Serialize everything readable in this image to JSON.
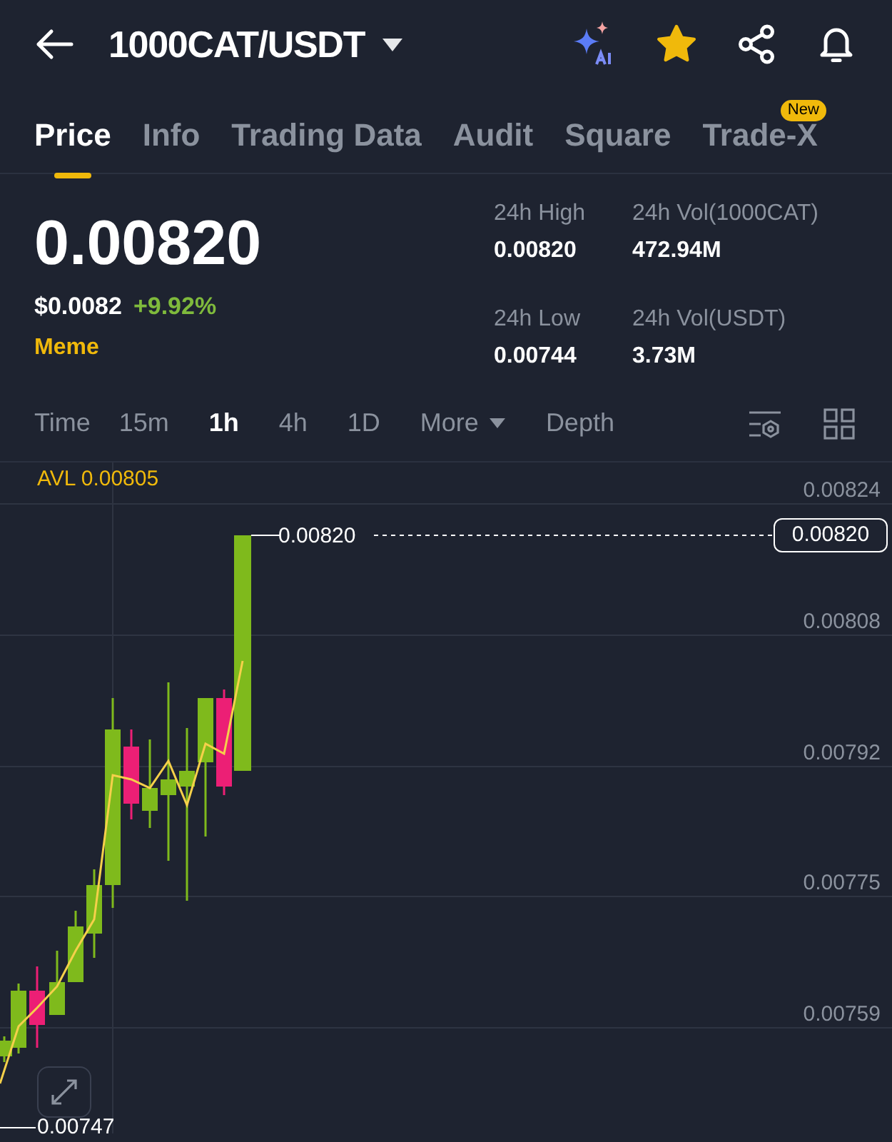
{
  "header": {
    "pair": "1000CAT/USDT",
    "favorite": true
  },
  "tabs": [
    {
      "label": "Price",
      "selected": true
    },
    {
      "label": "Info",
      "selected": false
    },
    {
      "label": "Trading Data",
      "selected": false
    },
    {
      "label": "Audit",
      "selected": false
    },
    {
      "label": "Square",
      "selected": false
    },
    {
      "label": "Trade-X",
      "selected": false,
      "badge": "New"
    }
  ],
  "ticker": {
    "price": "0.00820",
    "usd_price": "$0.0082",
    "change": "+9.92%",
    "tag": "Meme"
  },
  "stats": [
    {
      "label": "24h High",
      "value": "0.00820"
    },
    {
      "label": "24h Vol(1000CAT)",
      "value": "472.94M"
    },
    {
      "label": "24h Low",
      "value": "0.00744"
    },
    {
      "label": "24h Vol(USDT)",
      "value": "3.73M"
    }
  ],
  "intervals": [
    {
      "label": "Time",
      "kind": "interval",
      "selected": false
    },
    {
      "label": "15m",
      "kind": "interval",
      "selected": false
    },
    {
      "label": "1h",
      "kind": "interval",
      "selected": true
    },
    {
      "label": "4h",
      "kind": "interval",
      "selected": false
    },
    {
      "label": "1D",
      "kind": "interval",
      "selected": false
    },
    {
      "label": "More",
      "kind": "dropdown",
      "selected": false
    },
    {
      "label": "Depth",
      "kind": "interval",
      "selected": false
    }
  ],
  "chart": {
    "avl_label": "AVL 0.00805",
    "y_axis_labels": [
      "0.00824",
      "0.00808",
      "0.00792",
      "0.00775",
      "0.00759"
    ],
    "last_price": "0.00820",
    "last_price_axis": "0.00820",
    "low_marker": "0.00747"
  }
}
